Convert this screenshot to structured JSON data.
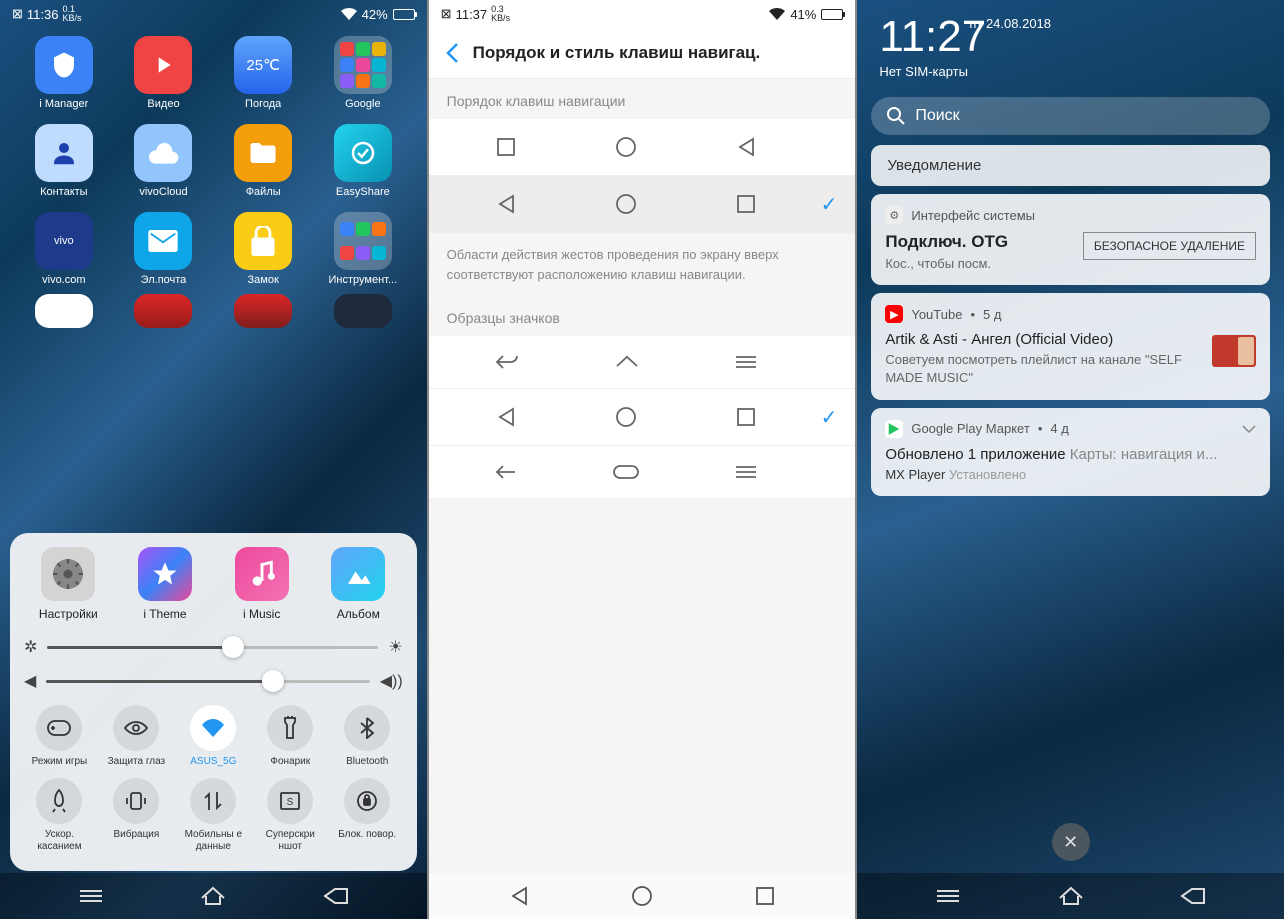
{
  "p1": {
    "status": {
      "time": "11:36",
      "speed": "0.1",
      "speed_unit": "KB/s",
      "wifi": true,
      "battery_pct": "42%",
      "battery_level": 42
    },
    "apps_visible": [
      {
        "label": "i Manager",
        "color": "#3b82f6"
      },
      {
        "label": "Видео",
        "color": "#ef4444"
      },
      {
        "label": "Погода",
        "color": "#60a5fa",
        "badge": "25°C"
      },
      {
        "label": "Google",
        "folder": true
      },
      {
        "label": "Контакты",
        "color": "#bfdbfe"
      },
      {
        "label": "vivoCloud",
        "color": "#93c5fd"
      },
      {
        "label": "Файлы",
        "color": "#f59e0b"
      },
      {
        "label": "EasyShare",
        "color": "#06b6d4"
      },
      {
        "label": "vivo.com",
        "color": "#1e3a8a"
      },
      {
        "label": "Эл.почта",
        "color": "#0ea5e9"
      },
      {
        "label": "Замок",
        "color": "#facc15"
      },
      {
        "label": "Инструмент...",
        "folder": true
      }
    ],
    "cp_apps": [
      {
        "label": "Настройки",
        "bg": "#d0d0d0"
      },
      {
        "label": "i Theme",
        "bg": "linear-gradient(135deg,#a855f7,#3b82f6,#ec4899)"
      },
      {
        "label": "i Music",
        "bg": "linear-gradient(135deg,#ec4899,#f472b6)"
      },
      {
        "label": "Альбом",
        "bg": "linear-gradient(135deg,#60a5fa,#22d3ee)"
      }
    ],
    "brightness": 56,
    "volume": 70,
    "toggles_row1": [
      {
        "label": "Режим игры",
        "icon": "gamepad"
      },
      {
        "label": "Защита глаз",
        "icon": "eye"
      },
      {
        "label": "ASUS_5G",
        "icon": "wifi",
        "active": true
      },
      {
        "label": "Фонарик",
        "icon": "flashlight"
      },
      {
        "label": "Bluetooth",
        "icon": "bluetooth"
      }
    ],
    "toggles_row2": [
      {
        "label": "Ускор. касанием",
        "icon": "rocket"
      },
      {
        "label": "Вибрация",
        "icon": "vibrate"
      },
      {
        "label": "Мобильны е данные",
        "icon": "data"
      },
      {
        "label": "Суперскри ншот",
        "icon": "screenshot"
      },
      {
        "label": "Блок. повор.",
        "icon": "rotate-lock"
      }
    ]
  },
  "p2": {
    "status": {
      "time": "11:37",
      "speed": "0.3",
      "speed_unit": "KB/s",
      "battery_pct": "41%",
      "battery_level": 41
    },
    "title": "Порядок и стиль клавиш навигац.",
    "section1": "Порядок клавиш навигации",
    "option1": [
      "square",
      "circle",
      "triangle-left"
    ],
    "option2": [
      "triangle-left",
      "circle",
      "square"
    ],
    "desc": "Области действия жестов проведения по экрану вверх соответствуют расположению клавиш навигации.",
    "section2": "Образцы значков",
    "sample1": [
      "back-arrow-u",
      "home-u",
      "menu-lines"
    ],
    "sample2": [
      "triangle-left",
      "circle",
      "square"
    ],
    "sample3": [
      "arrow-left",
      "pill",
      "menu-lines"
    ]
  },
  "p3": {
    "time": "11:27",
    "date": "пт 24.08.2018",
    "sim": "Нет SIM-карты",
    "search_placeholder": "Поиск",
    "section_label": "Уведомление",
    "notif1": {
      "app": "Интерфейс системы",
      "title": "Подключ. OTG",
      "body": "Кос., чтобы посм.",
      "action": "БЕЗОПАСНОЕ УДАЛЕНИЕ"
    },
    "notif2": {
      "app": "YouTube",
      "age": "5 д",
      "title": "Artik & Asti - Ангел (Official Video)",
      "body": "Советуем посмотреть плейлист на канале \"SELF MADE MUSIC\""
    },
    "notif3": {
      "app": "Google Play Маркет",
      "age": "4 д",
      "title_a": "Обновлено 1 приложение",
      "title_b": "Карты: навигация и...",
      "sub_a": "MX Player",
      "sub_b": "Установлено"
    }
  }
}
